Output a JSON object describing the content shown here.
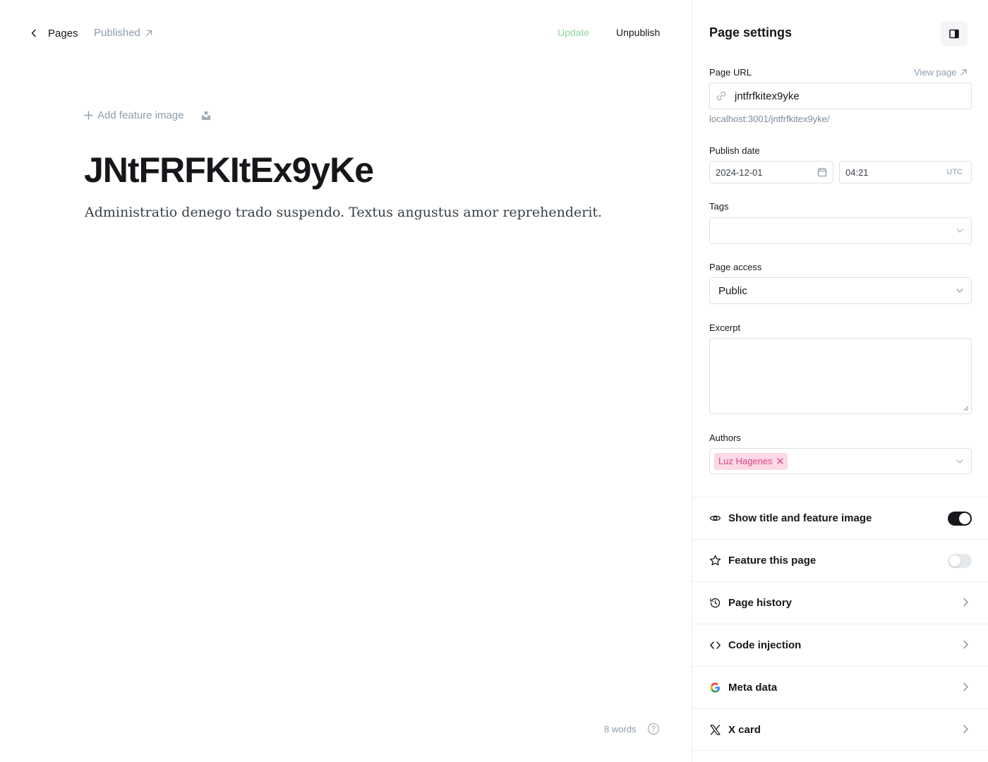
{
  "editor": {
    "back_label": "Pages",
    "status_label": "Published",
    "update_label": "Update",
    "unpublish_label": "Unpublish",
    "add_feature_image_label": "Add feature image",
    "title": "JNtFRFKItEx9yKe",
    "body": "Administratio denego trado suspendo. Textus angustus amor reprehenderit.",
    "word_count": "8 words"
  },
  "panel": {
    "title": "Page settings",
    "page_url_label": "Page URL",
    "view_page_label": "View page",
    "slug_value": "jntfrfkitex9yke",
    "full_url": "localhost:3001/jntfrfkitex9yke/",
    "publish_date_label": "Publish date",
    "date_value": "2024-12-01",
    "time_value": "04:21",
    "timezone": "UTC",
    "tags_label": "Tags",
    "page_access_label": "Page access",
    "page_access_value": "Public",
    "excerpt_label": "Excerpt",
    "excerpt_value": "",
    "authors_label": "Authors",
    "authors": [
      "Luz Hagenes"
    ],
    "rows": {
      "show_title": {
        "label": "Show title and feature image",
        "enabled": true
      },
      "feature_page": {
        "label": "Feature this page",
        "enabled": false
      },
      "history": {
        "label": "Page history"
      },
      "code_injection": {
        "label": "Code injection"
      },
      "meta_data": {
        "label": "Meta data"
      },
      "x_card": {
        "label": "X card"
      }
    }
  },
  "colors": {
    "update_green": "#8fd99c",
    "author_chip_bg": "#fbd9e6",
    "author_chip_text": "#e0437f",
    "toggle_on": "#15171a",
    "toggle_off": "#e6e9ec"
  },
  "icons": {
    "back": "chevron-left-icon",
    "status": "arrow-up-right-icon",
    "feature": "plus-icon",
    "unsplash": "unsplash-icon",
    "help": "question-circle-icon",
    "panel_toggle": "sidebar-icon",
    "url": "link-icon",
    "date": "calendar-icon",
    "show_title": "eye-icon",
    "feature_page": "star-icon",
    "history": "history-icon",
    "code": "code-icon",
    "meta": "google-icon",
    "x": "x-logo-icon"
  }
}
